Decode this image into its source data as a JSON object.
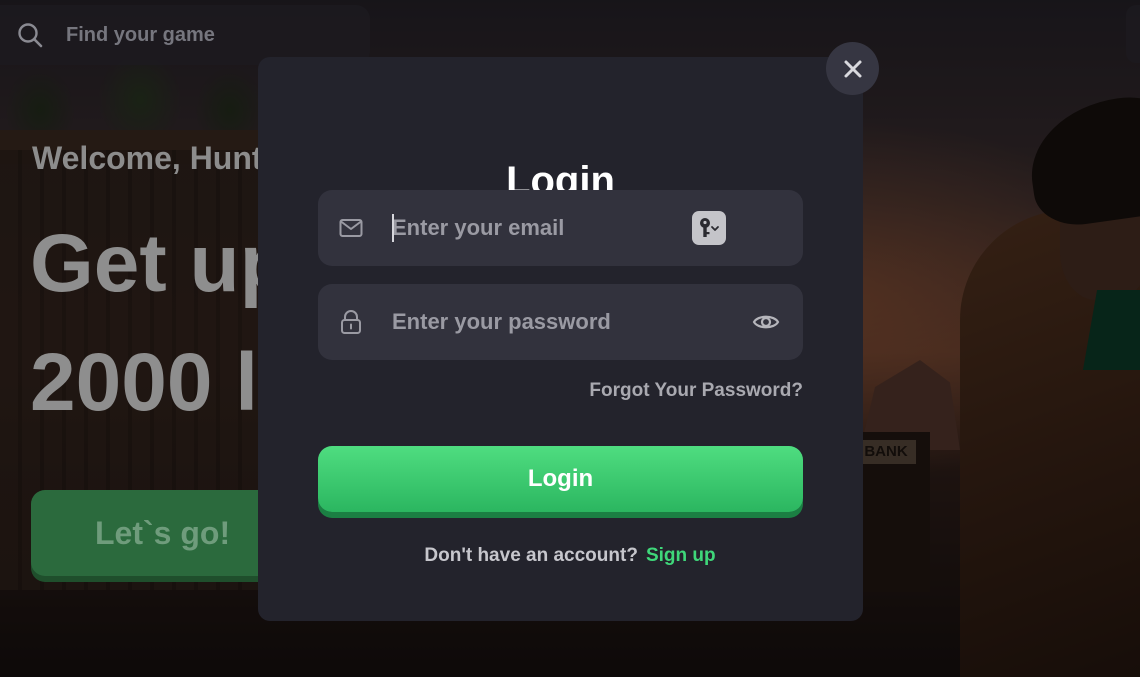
{
  "search": {
    "placeholder": "Find your game"
  },
  "hero": {
    "welcome": "Welcome, Hunt",
    "headline": "Get up\n2000 l",
    "cta_label": "Let`s go!"
  },
  "modal": {
    "title": "Login",
    "email_placeholder": "Enter your email",
    "password_placeholder": "Enter your password",
    "forgot_label": "Forgot Your Password?",
    "login_label": "Login",
    "no_account_text": "Don't have an account?",
    "signup_label": "Sign up"
  },
  "background": {
    "bank_sign": "BANK"
  },
  "icons": {
    "search": "search-icon",
    "close": "close-icon",
    "email": "mail-icon",
    "lock": "lock-icon",
    "key": "key-icon",
    "eye": "eye-icon"
  },
  "colors": {
    "modal_bg": "#23232c",
    "field_bg": "#32323d",
    "accent_green": "#3fd77a",
    "button_green": "#2bb660"
  }
}
